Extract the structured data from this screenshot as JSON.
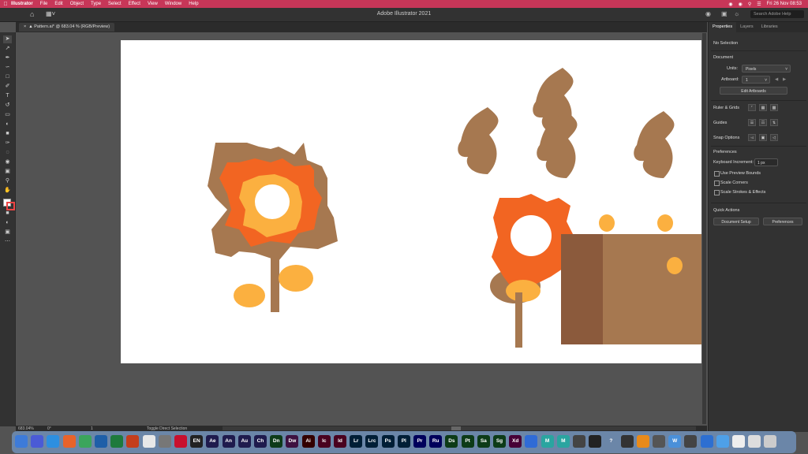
{
  "menubar": {
    "app": "Illustrator",
    "items": [
      "File",
      "Edit",
      "Object",
      "Type",
      "Select",
      "Effect",
      "View",
      "Window",
      "Help"
    ],
    "clock": "Fri 26 Nov  08:53"
  },
  "appbar": {
    "title": "Adobe Illustrator 2021",
    "search_placeholder": "Search Adobe Help"
  },
  "document": {
    "tab_label": "Pattern.ai* @ 683.04 % (RGB/Preview)"
  },
  "panel": {
    "tabs": [
      "Properties",
      "Layers",
      "Libraries"
    ],
    "selection": "No Selection",
    "document_heading": "Document",
    "units_label": "Units:",
    "units_value": "Pixels",
    "artboard_label": "Artboard:",
    "artboard_value": "1",
    "edit_artboards": "Edit Artboards",
    "ruler_grids": "Ruler & Grids",
    "guides": "Guides",
    "snap_options": "Snap Options",
    "preferences_heading": "Preferences",
    "keyboard_increment_label": "Keyboard Increment:",
    "keyboard_increment_value": "1 px",
    "use_preview_bounds": "Use Preview Bounds",
    "scale_corners": "Scale Corners",
    "scale_strokes": "Scale Strokes & Effects",
    "quick_actions": "Quick Actions",
    "document_setup": "Document Setup",
    "preferences_button": "Preferences"
  },
  "status": {
    "zoom": "683.04%",
    "rotation": "0°",
    "artboard": "1",
    "tool": "Toggle Direct Selection"
  },
  "dock": [
    {
      "label": "",
      "color": "#3d7bd9"
    },
    {
      "label": "",
      "color": "#4a5bd6"
    },
    {
      "label": "",
      "color": "#2d8fe0"
    },
    {
      "label": "",
      "color": "#e8632b"
    },
    {
      "label": "",
      "color": "#3ba55c"
    },
    {
      "label": "",
      "color": "#1e5fa8"
    },
    {
      "label": "",
      "color": "#1e7a3c"
    },
    {
      "label": "",
      "color": "#c43e1c"
    },
    {
      "label": "",
      "color": "#e8e8e8"
    },
    {
      "label": "",
      "color": "#777"
    },
    {
      "label": "",
      "color": "#c8102e"
    },
    {
      "label": "EN",
      "color": "#222"
    },
    {
      "label": "Ae",
      "color": "#1f1b4d"
    },
    {
      "label": "An",
      "color": "#1f1b4d"
    },
    {
      "label": "Au",
      "color": "#1f1b4d"
    },
    {
      "label": "Ch",
      "color": "#1f1b4d"
    },
    {
      "label": "Dn",
      "color": "#0d3b18"
    },
    {
      "label": "Dw",
      "color": "#3e1140"
    },
    {
      "label": "Ai",
      "color": "#330000"
    },
    {
      "label": "Ic",
      "color": "#49021f"
    },
    {
      "label": "Id",
      "color": "#49021f"
    },
    {
      "label": "Lr",
      "color": "#001e36"
    },
    {
      "label": "Lrc",
      "color": "#001e36"
    },
    {
      "label": "Ps",
      "color": "#001e36"
    },
    {
      "label": "Pl",
      "color": "#001e36"
    },
    {
      "label": "Pr",
      "color": "#00005b"
    },
    {
      "label": "Ru",
      "color": "#00005b"
    },
    {
      "label": "Ds",
      "color": "#0d3b18"
    },
    {
      "label": "Pt",
      "color": "#0d3b18"
    },
    {
      "label": "Sa",
      "color": "#0d3b18"
    },
    {
      "label": "Sg",
      "color": "#0d3b18"
    },
    {
      "label": "Xd",
      "color": "#470137"
    },
    {
      "label": "",
      "color": "#2f6bd6"
    },
    {
      "label": "M",
      "color": "#2aa5a0"
    },
    {
      "label": "M",
      "color": "#2aa5a0"
    },
    {
      "label": "",
      "color": "#444"
    },
    {
      "label": "",
      "color": "#222"
    },
    {
      "label": "?",
      "color": "#6b86a8"
    },
    {
      "label": "",
      "color": "#333"
    },
    {
      "label": "",
      "color": "#e88a1a"
    },
    {
      "label": "",
      "color": "#555"
    },
    {
      "label": "W",
      "color": "#4a90d9"
    },
    {
      "label": "",
      "color": "#444"
    },
    {
      "label": "",
      "color": "#2d6fd1"
    },
    {
      "label": "",
      "color": "#4ea0e8"
    },
    {
      "label": "",
      "color": "#eee"
    },
    {
      "label": "",
      "color": "#ddd"
    },
    {
      "label": "",
      "color": "#ccc"
    },
    {
      "label": "",
      "color": "#6b86a8"
    }
  ]
}
